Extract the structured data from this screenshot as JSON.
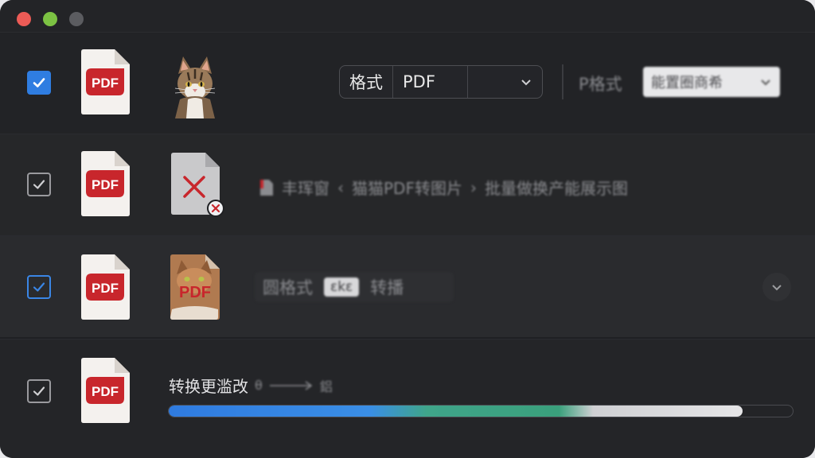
{
  "window": {
    "lights": [
      "close",
      "minimize",
      "zoom"
    ]
  },
  "rows": [
    {
      "checked": true,
      "file_icon_label": "PDF",
      "format_label": "格式",
      "format_value": "PDF",
      "option_label": "P格式",
      "option_value": "能置圈商希"
    },
    {
      "checked": true,
      "file_icon_label": "PDF",
      "path": [
        "丰珲窗",
        "猫猫PDF转图片",
        "批量做换产能展示图"
      ]
    },
    {
      "checked": true,
      "file_icon_label": "PDF",
      "thumb_label": "PDF",
      "format_label": "圆格式",
      "format_value": "εkε",
      "mode_label": "转播"
    },
    {
      "checked": true,
      "file_icon_label": "PDF",
      "status_text": "转换更滥改",
      "status_from": "θ",
      "status_to": "鋁",
      "progress_fraction": 0.92
    }
  ]
}
